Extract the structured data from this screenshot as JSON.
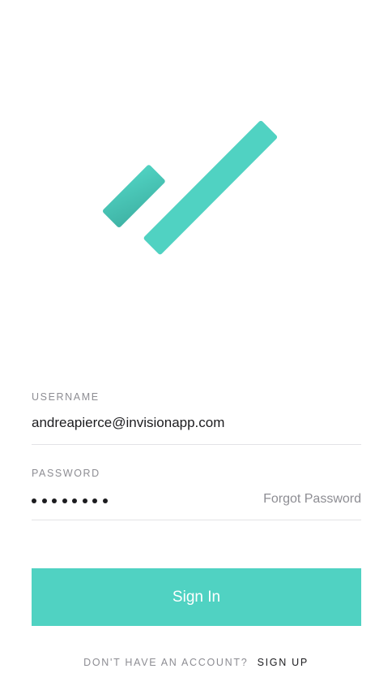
{
  "brand": {
    "logo_icon": "checkmark-icon",
    "accent_color": "#50d2c2"
  },
  "username": {
    "label": "USERNAME",
    "value": "andreapierce@invisionapp.com"
  },
  "password": {
    "label": "PASSWORD",
    "masked_length": 8,
    "forgot_label": "Forgot Password"
  },
  "actions": {
    "sign_in_label": "Sign In"
  },
  "footer": {
    "question": "DON'T HAVE AN ACCOUNT?",
    "sign_up_label": "SIGN UP"
  }
}
